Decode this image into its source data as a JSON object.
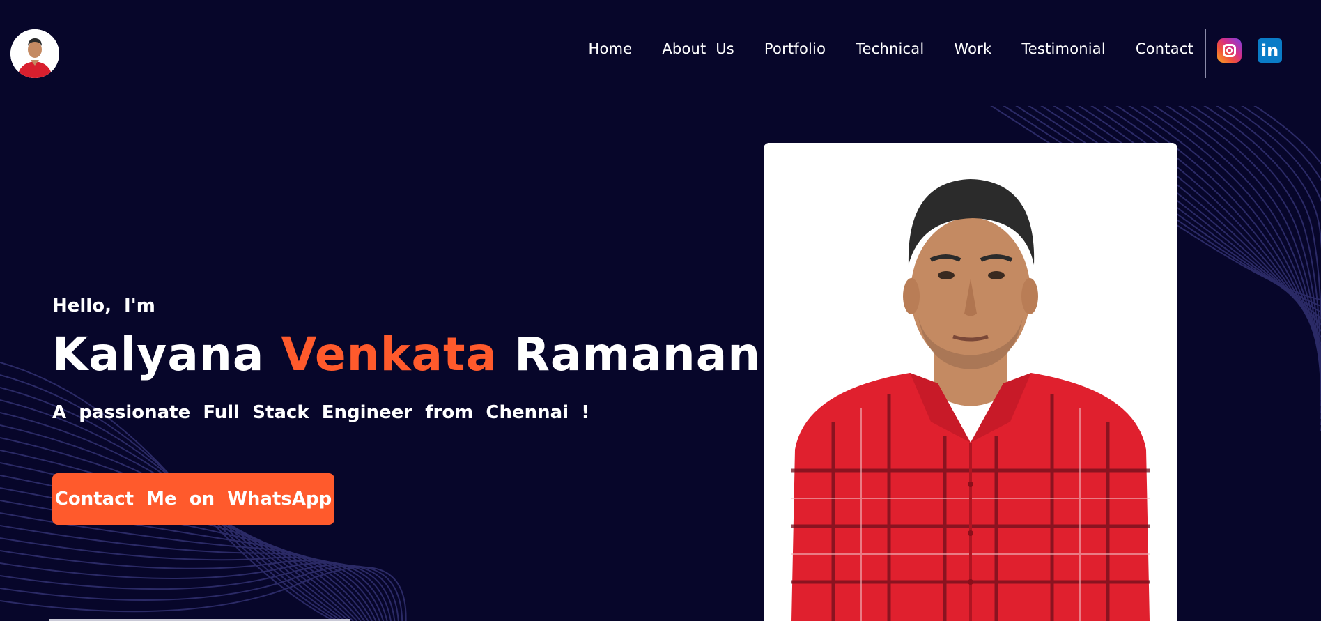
{
  "header": {
    "avatar_icon": "person-avatar-icon",
    "nav": [
      {
        "label": "Home"
      },
      {
        "label": "About  Us"
      },
      {
        "label": "Portfolio"
      },
      {
        "label": "Technical"
      },
      {
        "label": "Work"
      },
      {
        "label": "Testimonial"
      },
      {
        "label": "Contact"
      }
    ],
    "social": {
      "instagram_icon": "instagram-icon",
      "linkedin_icon": "linkedin-icon",
      "linkedin_glyph": "in"
    }
  },
  "hero": {
    "greeting": "Hello,  I'm",
    "name_first": "Kalyana",
    "name_middle": "Venkata",
    "name_last": "Ramanan",
    "tagline": "A  passionate  Full  Stack  Engineer  from  Chennai  !",
    "cta_label": "Contact  Me  on  WhatsApp",
    "photo_icon": "profile-photo-icon"
  },
  "colors": {
    "background": "#07062a",
    "accent": "#ff5a2c",
    "text": "#ffffff",
    "wave_lines": "#2b2a66",
    "shirt": "#e0202e"
  }
}
